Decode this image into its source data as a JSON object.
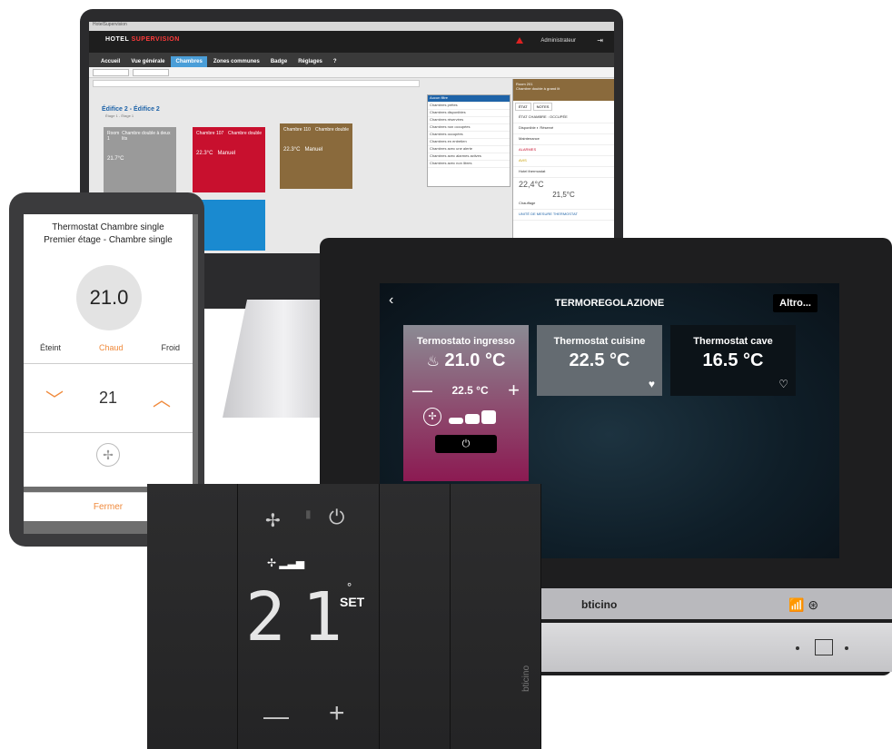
{
  "hotel_supervision": {
    "logo_a": "HOTEL",
    "logo_b": "SUPERVISION",
    "user": "Administrateur",
    "nav": [
      "Accueil",
      "Vue générale",
      "Chambres",
      "Zones communes",
      "Badge",
      "Réglages"
    ],
    "active_nav": "Chambres",
    "building_title": "Édifice 2 - Édifice 2",
    "floor_subtitle": "Étage 1 - Étage 1",
    "filter_placeholder": "Aucun filtre",
    "filters": [
      "Aucun filtre",
      "Chambres prêtes",
      "Chambres disponibles",
      "Chambres réservées",
      "Chambres non occupées",
      "Chambres occupées",
      "Chambres en entretien",
      "Chambres avec une alerte",
      "Chambres avec alarmes actives",
      "Chambres avec non libres"
    ],
    "tiles": [
      {
        "num": "Room 1",
        "type": "Chambre double à deux lits",
        "temp": "21.7°C",
        "mode": "",
        "color": "#9a9a9a"
      },
      {
        "num": "Chambre 107",
        "type": "Chambre double",
        "temp": "22.3°C",
        "mode": "Manuel",
        "color": "#c8102e"
      },
      {
        "num": "Chambre 110",
        "type": "Chambre double",
        "temp": "22.3°C",
        "mode": "Manuel",
        "color": "#8a6a3c"
      }
    ],
    "panel": {
      "room": "Room 201",
      "room_type": "Chambre double à grand lit",
      "tabs": [
        "ÉTAT",
        "NOTES"
      ],
      "state_label": "ÉTAT CHAMBRE : OCCUPÉE",
      "toggle_left": "Disponible",
      "toggle_right": "Réservé",
      "maintenance": "Maintenance",
      "alarms": "ALARMES",
      "notices": "AVIS",
      "thermostat": "Hotel thermostat",
      "temp": "22,4°C",
      "setpoint": "21,5°C",
      "function": "Chauffage",
      "meter": "UNITÉ DE MESURE THERMOSTAT"
    }
  },
  "phone": {
    "title_line1": "Thermostat Chambre single",
    "title_line2": "Premier étage - Chambre single",
    "temperature": "21.0",
    "modes": [
      "Éteint",
      "Chaud",
      "Froid"
    ],
    "active_mode": "Chaud",
    "setpoint": "21",
    "close_label": "Fermer"
  },
  "touchscreen": {
    "title": "TERMOREGOLAZIONE",
    "more_label": "Altro...",
    "cards": [
      {
        "name": "Termostato ingresso",
        "temp": "21.0 °C",
        "setpoint": "22.5 °C"
      },
      {
        "name": "Thermostat cuisine",
        "temp": "22.5 °C"
      },
      {
        "name": "Thermostat cave",
        "temp": "16.5 °C"
      }
    ],
    "brand": "bticino"
  },
  "wall_thermostat": {
    "display_digits": "21",
    "set_label": "SET",
    "brand": "bticino"
  }
}
